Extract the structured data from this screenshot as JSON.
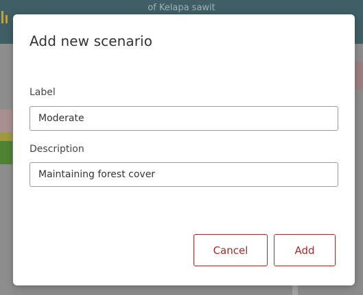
{
  "background": {
    "header_title": "of Kelapa sawit"
  },
  "dialog": {
    "title": "Add new scenario",
    "label_field": {
      "label": "Label",
      "value": "Moderate"
    },
    "description_field": {
      "label": "Description",
      "value": "Maintaining forest cover"
    },
    "cancel_label": "Cancel",
    "add_label": "Add"
  },
  "colors": {
    "accent": "#a52a2a",
    "overlay": "#7a7a7a",
    "header": "#3f5e66"
  }
}
